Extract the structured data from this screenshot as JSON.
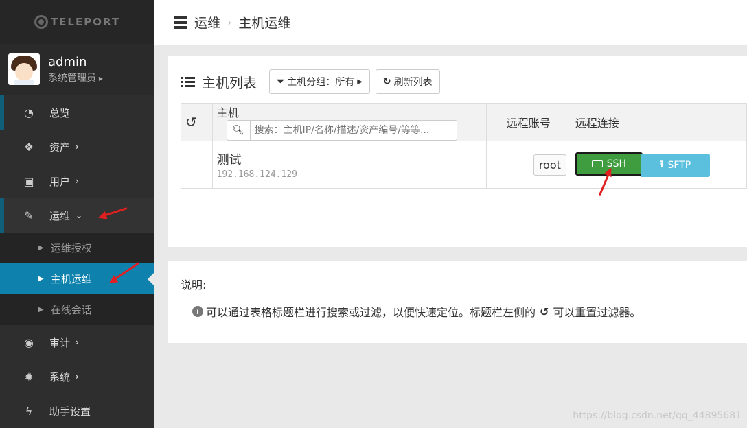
{
  "sidebar": {
    "logo_text": "TELEPORT",
    "user": {
      "name": "admin",
      "role": "系统管理员"
    },
    "items": [
      {
        "label": "总览",
        "icon": "dashboard-icon"
      },
      {
        "label": "资产",
        "icon": "cubes-icon"
      },
      {
        "label": "用户",
        "icon": "address-card-icon"
      },
      {
        "label": "运维",
        "icon": "wrench-icon"
      },
      {
        "label": "审计",
        "icon": "eye-icon"
      },
      {
        "label": "系统",
        "icon": "cog-icon"
      },
      {
        "label": "助手设置",
        "icon": "bolt-icon"
      }
    ],
    "subitems": [
      "运维授权",
      "主机运维",
      "在线会话"
    ]
  },
  "header": {
    "section": "运维",
    "page": "主机运维"
  },
  "host_list": {
    "title": "主机列表",
    "group_filter": "主机分组：所有",
    "refresh_label": "刷新列表",
    "columns": {
      "host": "主机",
      "account": "远程账号",
      "connect": "远程连接"
    },
    "search_placeholder": "搜索：主机IP/名称/描述/资产编号/等等...",
    "rows": [
      {
        "name": "测试",
        "ip": "192.168.124.129",
        "account": "root",
        "ssh_label": "SSH",
        "sftp_label": "SFTP"
      }
    ]
  },
  "notes": {
    "title": "说明:",
    "line_part1": "可以通过表格标题栏进行搜索或过滤，以便快速定位。标题栏左侧的",
    "line_part2": "可以重置过滤器。"
  },
  "watermark": "https://blog.csdn.net/qq_44895681",
  "colors": {
    "sidebar_bg": "#2e2e2e",
    "selected_bg": "#0e82ad",
    "ssh_green": "#3f9d3f",
    "sftp_blue": "#5bc0de",
    "annotation_red": "#e02020"
  }
}
